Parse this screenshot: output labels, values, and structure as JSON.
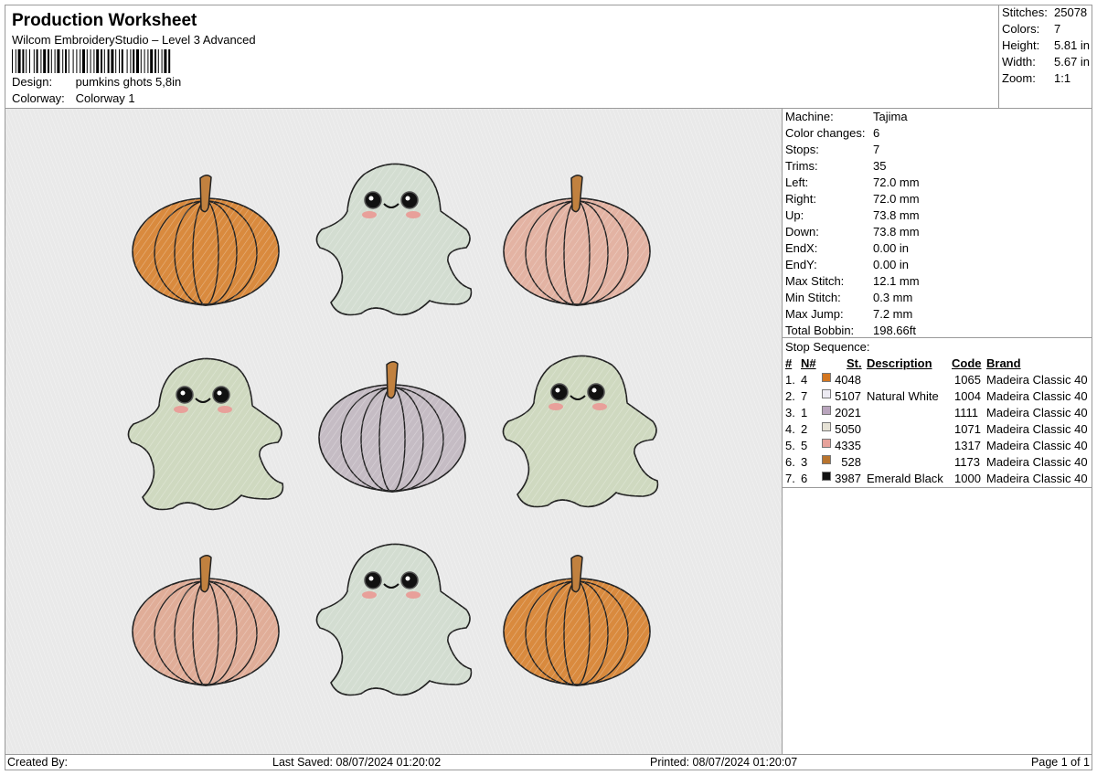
{
  "header": {
    "title": "Production Worksheet",
    "software": "Wilcom EmbroideryStudio – Level 3 Advanced",
    "design_label": "Design:",
    "design_value": "pumkins ghots 5,8in",
    "colorway_label": "Colorway:",
    "colorway_value": "Colorway 1"
  },
  "stats": {
    "stitches_label": "Stitches:",
    "stitches_value": "25078",
    "colors_label": "Colors:",
    "colors_value": "7",
    "height_label": "Height:",
    "height_value": "5.81 in",
    "width_label": "Width:",
    "width_value": "5.67 in",
    "zoom_label": "Zoom:",
    "zoom_value": "1:1"
  },
  "machine": {
    "rows": [
      {
        "label": "Machine:",
        "value": "Tajima"
      },
      {
        "label": "Color changes:",
        "value": "6"
      },
      {
        "label": "Stops:",
        "value": "7"
      },
      {
        "label": "Trims:",
        "value": "35"
      },
      {
        "label": "Left:",
        "value": "72.0 mm"
      },
      {
        "label": "Right:",
        "value": "72.0 mm"
      },
      {
        "label": "Up:",
        "value": "73.8 mm"
      },
      {
        "label": "Down:",
        "value": "73.8 mm"
      },
      {
        "label": "EndX:",
        "value": "0.00 in"
      },
      {
        "label": "EndY:",
        "value": "0.00 in"
      },
      {
        "label": "Max Stitch:",
        "value": "12.1 mm"
      },
      {
        "label": "Min Stitch:",
        "value": "0.3 mm"
      },
      {
        "label": "Max Jump:",
        "value": "7.2 mm"
      },
      {
        "label": "Total Bobbin:",
        "value": "198.66ft"
      }
    ]
  },
  "stop_sequence": {
    "title": "Stop Sequence:",
    "headers": {
      "num": "#",
      "n": "N#",
      "st": "St.",
      "description": "Description",
      "code": "Code",
      "brand": "Brand"
    },
    "rows": [
      {
        "num": "1.",
        "n": "4",
        "color": "#d4761f",
        "st": "4048",
        "description": "",
        "code": "1065",
        "brand": "Madeira Classic 40"
      },
      {
        "num": "2.",
        "n": "7",
        "color": "#eceaf2",
        "st": "5107",
        "description": "Natural White",
        "code": "1004",
        "brand": "Madeira Classic 40"
      },
      {
        "num": "3.",
        "n": "1",
        "color": "#b9a5bd",
        "st": "2021",
        "description": "",
        "code": "1111",
        "brand": "Madeira Classic 40"
      },
      {
        "num": "4.",
        "n": "2",
        "color": "#e6e2d6",
        "st": "5050",
        "description": "",
        "code": "1071",
        "brand": "Madeira Classic 40"
      },
      {
        "num": "5.",
        "n": "5",
        "color": "#e7a29b",
        "st": "4335",
        "description": "",
        "code": "1317",
        "brand": "Madeira Classic 40"
      },
      {
        "num": "6.",
        "n": "3",
        "color": "#b8742e",
        "st": "528",
        "description": "",
        "code": "1173",
        "brand": "Madeira Classic 40"
      },
      {
        "num": "7.",
        "n": "6",
        "color": "#111111",
        "st": "3987",
        "description": "Emerald Black",
        "code": "1000",
        "brand": "Madeira Classic 40"
      }
    ]
  },
  "footer": {
    "created_by": "Created By:",
    "last_saved": "Last Saved: 08/07/2024 01:20:02",
    "printed": "Printed: 08/07/2024 01:20:07",
    "page": "Page 1 of 1"
  },
  "colors": {
    "orange_pumpkin": "#d98a3e",
    "pink_pumpkin": "#e3b3a3",
    "mauve_pumpkin": "#c5bcc4",
    "peach_pumpkin": "#e0ad98",
    "stem": "#c1813f",
    "ghost_a": "#d3ddd1",
    "ghost_b": "#cfd9c0",
    "outline": "#222222",
    "cheek": "#e8a09a",
    "canvas_bg": "#e9e9e9"
  }
}
